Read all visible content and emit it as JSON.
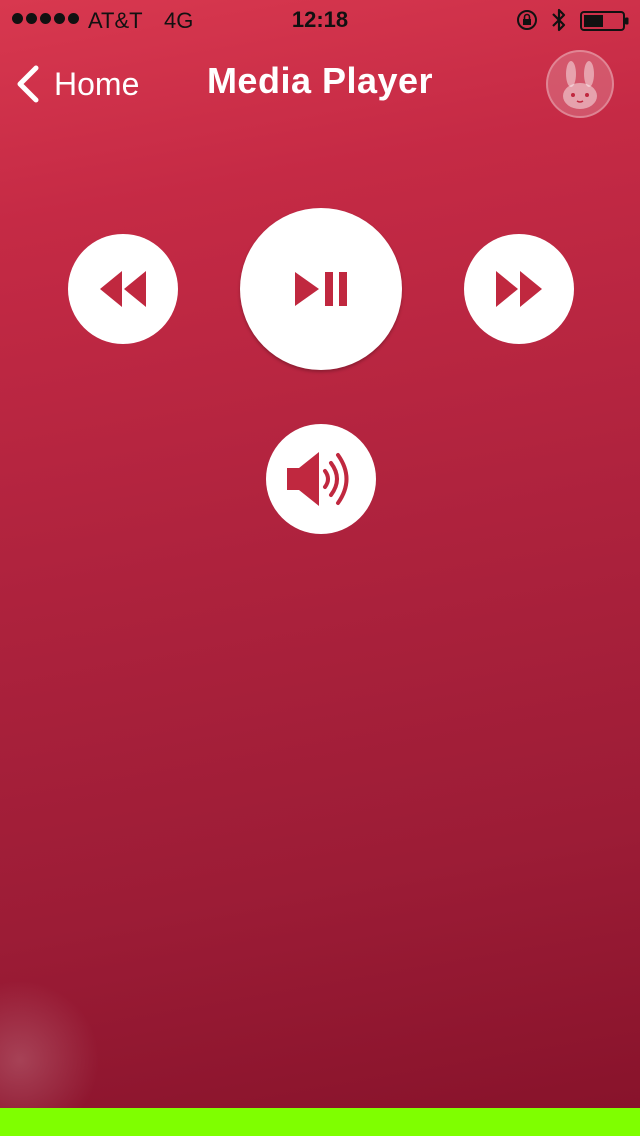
{
  "status_bar": {
    "carrier": "AT&T",
    "network": "4G",
    "time": "12:18",
    "signal_dots": 5,
    "battery_level": 0.5
  },
  "nav": {
    "back_label": "Home",
    "title": "Media Player"
  },
  "controls": {
    "rewind_icon": "rewind-icon",
    "play_pause_icon": "play-pause-icon",
    "forward_icon": "fast-forward-icon",
    "volume_icon": "speaker-icon"
  },
  "colors": {
    "background_top": "#d8384f",
    "background_bottom": "#86122a",
    "icon_red": "#c0283f",
    "bottom_strip": "#7fff00"
  }
}
